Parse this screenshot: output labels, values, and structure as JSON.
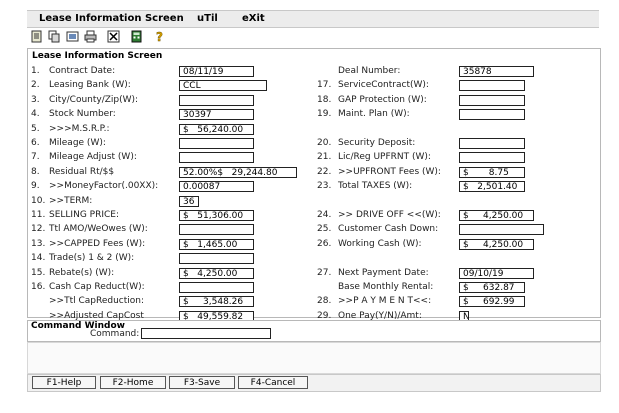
{
  "menu": {
    "title": "Lease Information Screen",
    "util": "uTil",
    "exit": "eXit"
  },
  "toolbar": {
    "icons": [
      "document-icon",
      "copy-icon",
      "view-icon",
      "print-icon",
      "close-x-icon",
      "calculator-icon",
      "help-icon"
    ]
  },
  "panel": {
    "title": "Lease Information Screen",
    "left_fields": [
      {
        "num": "1.",
        "label": "Contract Date:",
        "value": "08/11/19"
      },
      {
        "num": "2.",
        "label": "Leasing Bank   (W):",
        "value": "CCL"
      },
      {
        "num": "3.",
        "label": "City/County/Zip(W):",
        "value": ""
      },
      {
        "num": "4.",
        "label": "Stock Number:",
        "value": "30397"
      },
      {
        "num": "5.",
        "label": ">>>M.S.R.P.:",
        "value": "$   56,240.00"
      },
      {
        "num": "6.",
        "label": "Mileage (W):",
        "value": ""
      },
      {
        "num": "7.",
        "label": "Mileage Adjust (W):",
        "value": ""
      },
      {
        "num": "8.",
        "label": "Residual Rt/$$",
        "value": "52.00%$   29,244.80"
      },
      {
        "num": "9.",
        "label": ">>MoneyFactor(.00XX):",
        "value": "0.00087"
      },
      {
        "num": "10.",
        "label": ">>TERM:",
        "value": "36"
      },
      {
        "num": "11.",
        "label": "SELLING PRICE:",
        "value": "$   51,306.00"
      },
      {
        "num": "12.",
        "label": "Ttl AMO/WeOwes (W):",
        "value": ""
      },
      {
        "num": "13.",
        "label": ">>CAPPED Fees  (W):",
        "value": "$   1,465.00"
      },
      {
        "num": "14.",
        "label": "Trade(s) 1 & 2 (W):",
        "value": ""
      },
      {
        "num": "15.",
        "label": "Rebate(s)      (W):",
        "value": "$   4,250.00"
      },
      {
        "num": "16.",
        "label": "Cash Cap Reduct(W):",
        "value": ""
      },
      {
        "num": "",
        "label": ">>Ttl CapReduction:",
        "value": "$     3,548.26"
      },
      {
        "num": "",
        "label": ">>Adjusted CapCost",
        "value": "$   49,559.82"
      }
    ],
    "right_fields": [
      {
        "row": 0,
        "num": "",
        "label": "Deal Number:",
        "value": "35878"
      },
      {
        "row": 1,
        "num": "17.",
        "label": "ServiceContract(W):",
        "value": ""
      },
      {
        "row": 2,
        "num": "18.",
        "label": "GAP Protection (W):",
        "value": ""
      },
      {
        "row": 3,
        "num": "19.",
        "label": "Maint. Plan    (W):",
        "value": ""
      },
      {
        "row": 5,
        "num": "20.",
        "label": "Security Deposit:",
        "value": ""
      },
      {
        "row": 6,
        "num": "21.",
        "label": "Lic/Reg UPFRNT (W):",
        "value": ""
      },
      {
        "row": 7,
        "num": "22.",
        "label": ">>UPFRONT Fees (W):",
        "value": "$       8.75"
      },
      {
        "row": 8,
        "num": "23.",
        "label": "Total TAXES    (W):",
        "value": "$   2,501.40"
      },
      {
        "row": 10,
        "num": "24.",
        "label": ">> DRIVE OFF <<(W):",
        "value": "$     4,250.00"
      },
      {
        "row": 11,
        "num": "25.",
        "label": "Customer Cash Down:",
        "value": ""
      },
      {
        "row": 12,
        "num": "26.",
        "label": "Working Cash   (W):",
        "value": "$     4,250.00"
      },
      {
        "row": 14,
        "num": "27.",
        "label": "Next Payment Date:",
        "value": "09/10/19"
      },
      {
        "row": 15,
        "num": "",
        "label": "Base Monthly Rental:",
        "value": "$     632.87"
      },
      {
        "row": 16,
        "num": "28.",
        "label": ">>P A Y M E N T<<:",
        "value": "$     692.99"
      },
      {
        "row": 17,
        "num": "29.",
        "label": "One Pay(Y/N)/Amt:",
        "value": "N"
      }
    ]
  },
  "command": {
    "title": "Command Window",
    "label": "Command:",
    "value": ""
  },
  "fkeys": [
    "F1-Help",
    "F2-Home",
    "F3-Save",
    "F4-Cancel"
  ]
}
